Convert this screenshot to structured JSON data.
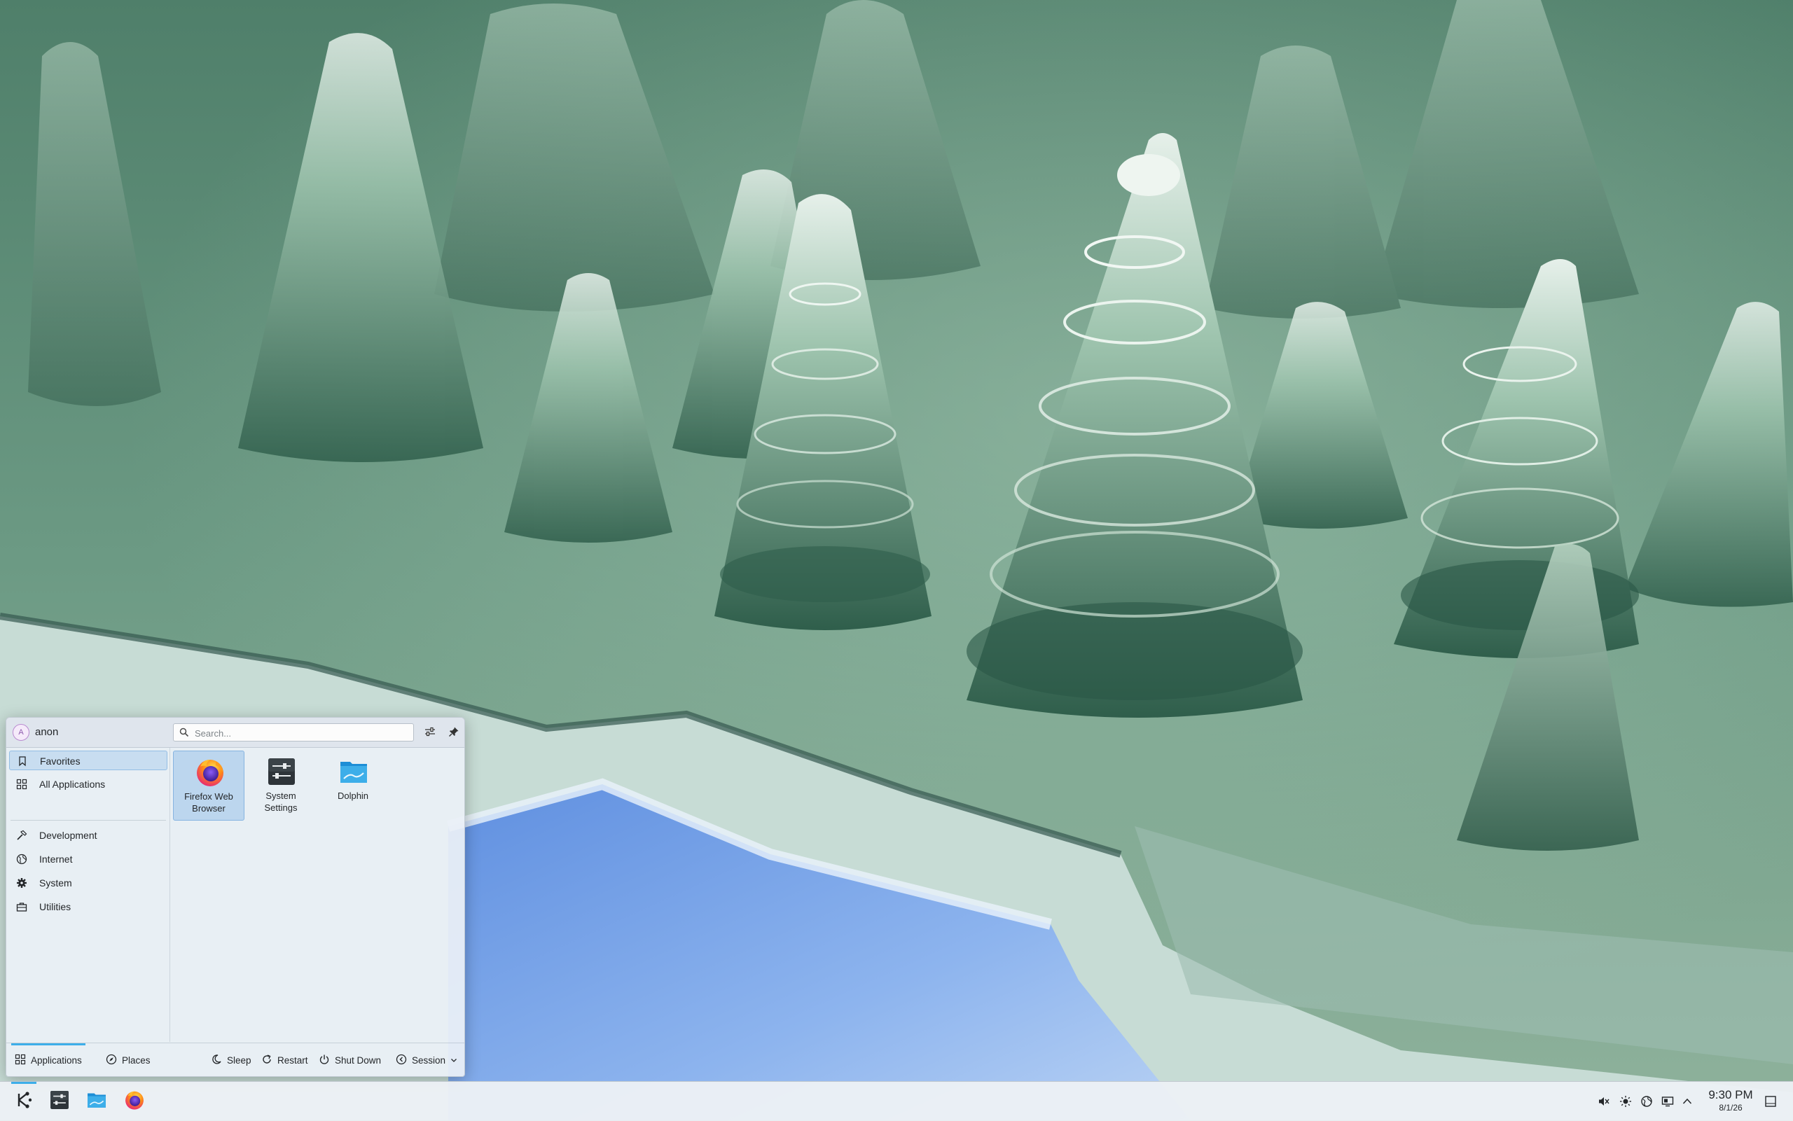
{
  "launcher": {
    "user": {
      "initial": "A",
      "name": "anon"
    },
    "search": {
      "placeholder": "Search..."
    },
    "sidebar": [
      {
        "id": "favorites",
        "label": "Favorites",
        "icon": "bookmark-icon",
        "active": true
      },
      {
        "id": "all-applications",
        "label": "All Applications",
        "icon": "grid-icon",
        "active": false
      },
      {
        "id": "development",
        "label": "Development",
        "icon": "hammer-icon",
        "active": false
      },
      {
        "id": "internet",
        "label": "Internet",
        "icon": "globe-icon",
        "active": false
      },
      {
        "id": "system",
        "label": "System",
        "icon": "gear-icon",
        "active": false
      },
      {
        "id": "utilities",
        "label": "Utilities",
        "icon": "toolbox-icon",
        "active": false
      }
    ],
    "apps": [
      {
        "label_line1": "Firefox Web",
        "label_line2": "Browser",
        "icon": "firefox-icon",
        "active": true
      },
      {
        "label_line1": "System",
        "label_line2": "Settings",
        "icon": "system-settings-icon",
        "active": false
      },
      {
        "label_line1": "Dolphin",
        "label_line2": "",
        "icon": "folder-icon",
        "active": false
      }
    ],
    "footer": {
      "applications": "Applications",
      "places": "Places",
      "sleep": "Sleep",
      "restart": "Restart",
      "shutdown": "Shut Down",
      "session": "Session"
    }
  },
  "taskbar": {
    "clock": {
      "time": "9:30 PM",
      "date": "8/1/26"
    }
  },
  "colors": {
    "accent": "#3daee9",
    "selection": "#c8ddf0"
  }
}
